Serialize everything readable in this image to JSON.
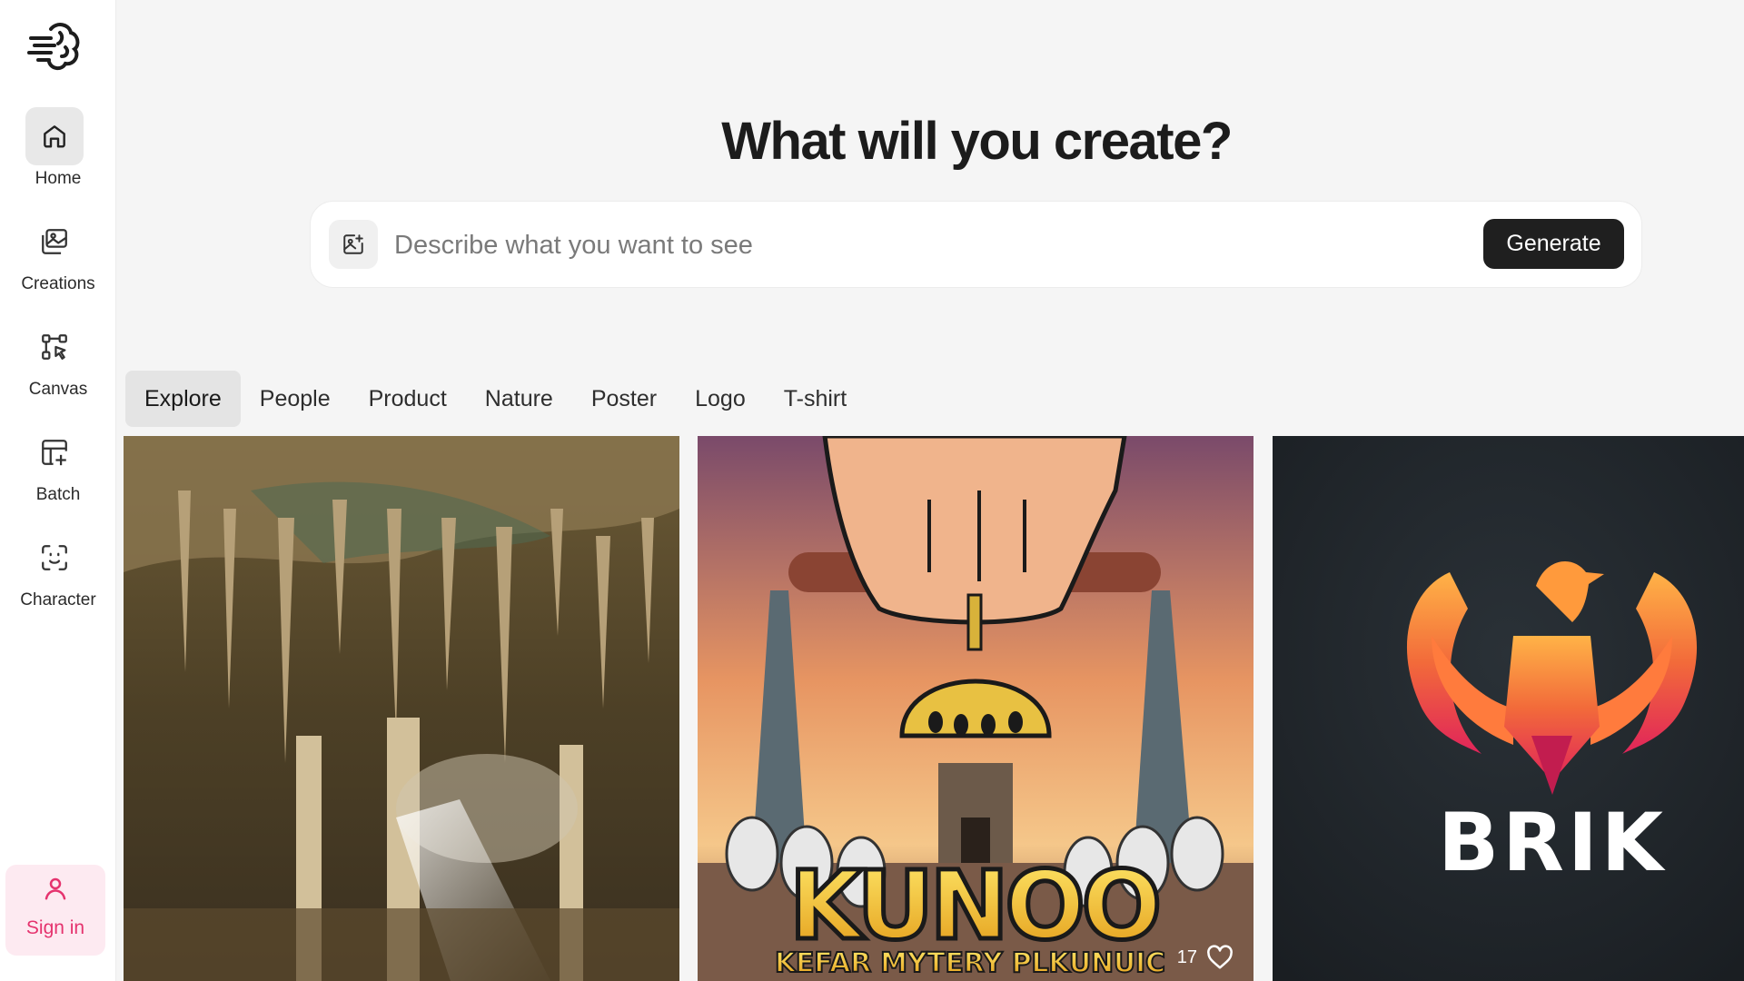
{
  "sidebar": {
    "logo_icon": "brain-speed-icon",
    "items": [
      {
        "label": "Home",
        "icon": "home-icon",
        "active": true
      },
      {
        "label": "Creations",
        "icon": "images-icon"
      },
      {
        "label": "Canvas",
        "icon": "canvas-nodes-icon"
      },
      {
        "label": "Batch",
        "icon": "batch-grid-icon"
      },
      {
        "label": "Character",
        "icon": "face-scan-icon"
      }
    ],
    "signin": {
      "label": "Sign in",
      "icon": "user-icon"
    }
  },
  "main": {
    "headline": "What will you create?",
    "prompt": {
      "placeholder": "Describe what you want to see",
      "image_button_icon": "image-add-icon",
      "generate_label": "Generate"
    },
    "tabs": [
      {
        "label": "Explore",
        "active": true
      },
      {
        "label": "People"
      },
      {
        "label": "Product"
      },
      {
        "label": "Nature"
      },
      {
        "label": "Poster"
      },
      {
        "label": "Logo"
      },
      {
        "label": "T-shirt"
      }
    ],
    "gallery": [
      {
        "subject": "cave-stalactites-image"
      },
      {
        "subject": "poster-image",
        "title_text": "KUNOO",
        "subtitle_text": "KEFAR MYTERY PLKUNUIC",
        "likes": "17",
        "like_icon": "heart-icon"
      },
      {
        "subject": "phoenix-logo-image",
        "brand_text": "BRIK"
      }
    ]
  },
  "colors": {
    "accent_pink": "#e5336e",
    "signin_bg": "#fdeaf1",
    "generate_bg": "#1f1f1f",
    "page_bg": "#f5f5f5"
  }
}
